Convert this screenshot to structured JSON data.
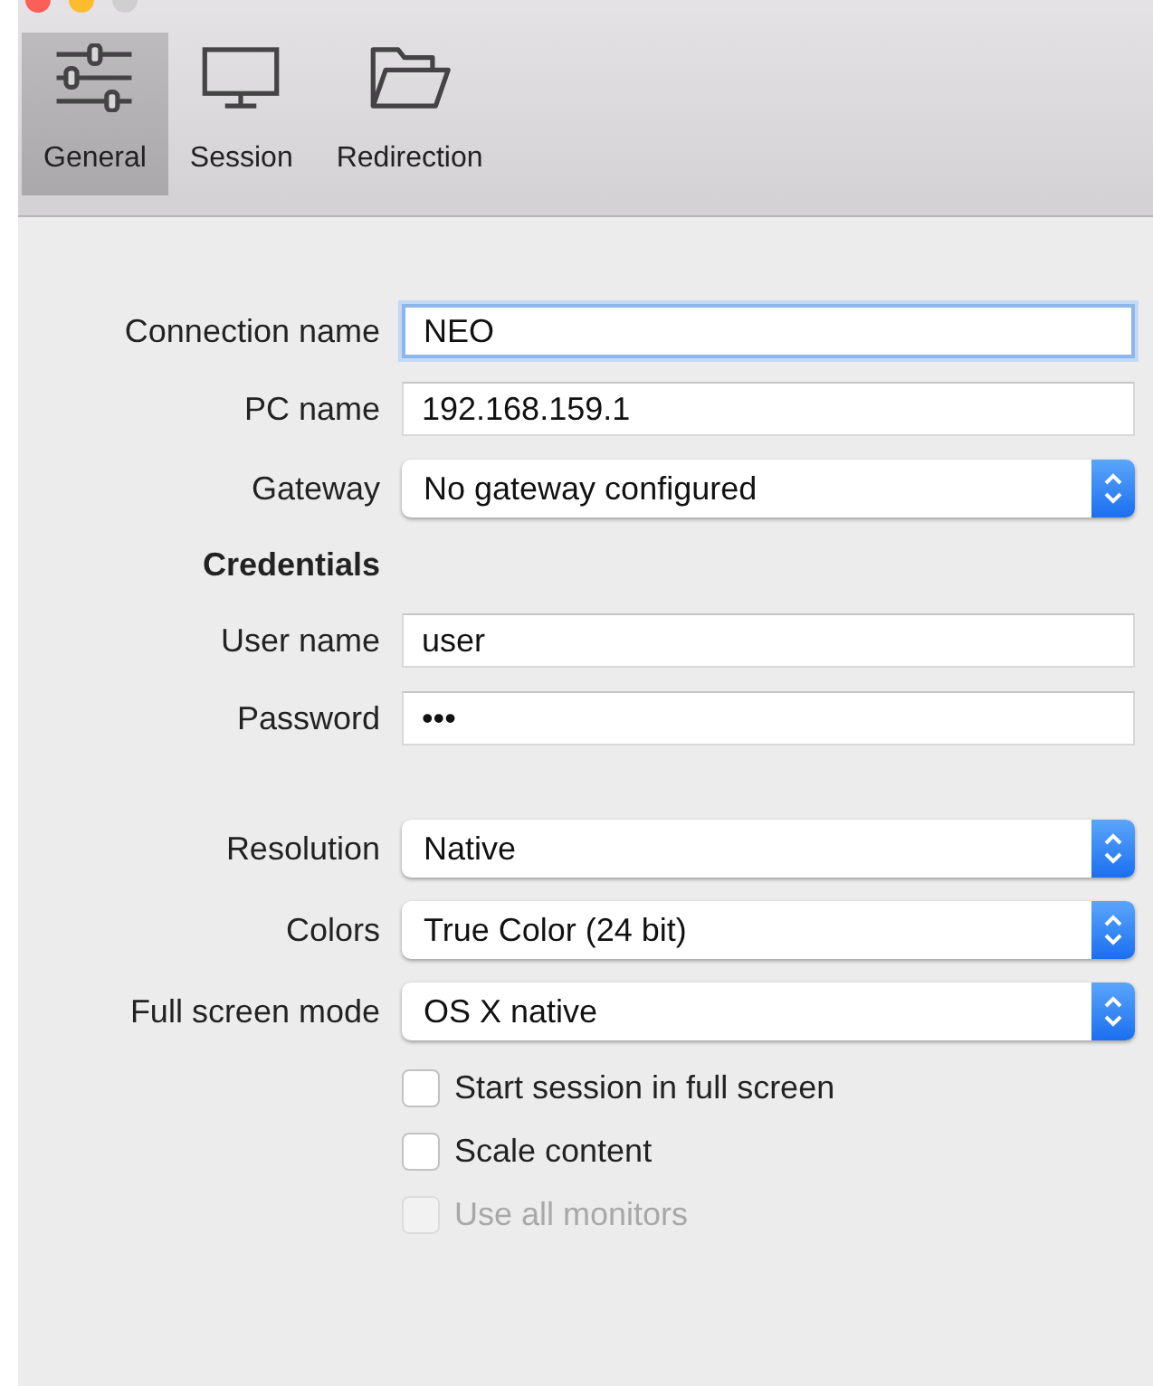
{
  "toolbar": {
    "tabs": [
      {
        "label": "General",
        "kind": "sliders",
        "selected": true
      },
      {
        "label": "Session",
        "kind": "monitor",
        "selected": false
      },
      {
        "label": "Redirection",
        "kind": "folder",
        "selected": false
      }
    ]
  },
  "form": {
    "connection": [
      {
        "kind": "text",
        "label": "Connection name",
        "value": "NEO",
        "focused": true
      },
      {
        "kind": "text",
        "label": "PC name",
        "value": "192.168.159.1",
        "focused": false
      },
      {
        "kind": "select",
        "label": "Gateway",
        "value": "No gateway configured"
      },
      {
        "kind": "heading",
        "label": "Credentials"
      },
      {
        "kind": "text",
        "label": "User name",
        "value": "user",
        "focused": false
      },
      {
        "kind": "text",
        "label": "Password",
        "value": "•••",
        "focused": false
      }
    ],
    "display": [
      {
        "kind": "select",
        "label": "Resolution",
        "value": "Native"
      },
      {
        "kind": "select",
        "label": "Colors",
        "value": "True Color (24 bit)"
      },
      {
        "kind": "select",
        "label": "Full screen mode",
        "value": "OS X native"
      }
    ],
    "options": [
      {
        "label": "Start session in full screen",
        "checked": false,
        "disabled": false
      },
      {
        "label": "Scale content",
        "checked": false,
        "disabled": false
      },
      {
        "label": "Use all monitors",
        "checked": false,
        "disabled": true
      }
    ]
  }
}
